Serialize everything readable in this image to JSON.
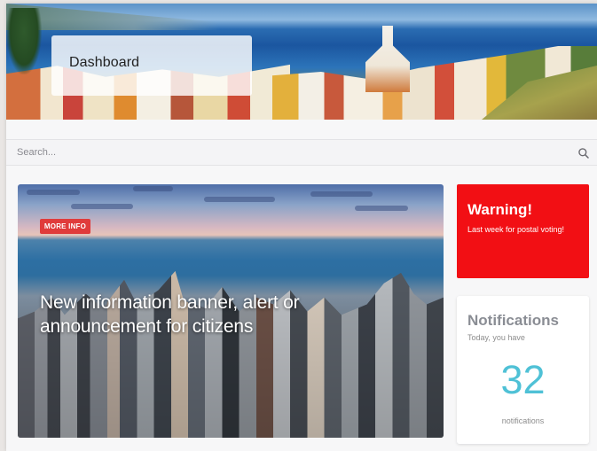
{
  "header": {
    "title": "Dashboard"
  },
  "search": {
    "placeholder": "Search...",
    "icon": "search-icon"
  },
  "news": {
    "badge": "MORE INFO",
    "headline": "New information banner, alert or announcement for citizens",
    "badge_color": "#e03b3b"
  },
  "warning": {
    "title": "Warning!",
    "text": "Last week for postal voting!",
    "color": "#f20f14"
  },
  "notifications": {
    "title": "Notifications",
    "subtitle": "Today, you have",
    "count": "32",
    "label": "notifications",
    "count_color": "#4fc1d6"
  }
}
